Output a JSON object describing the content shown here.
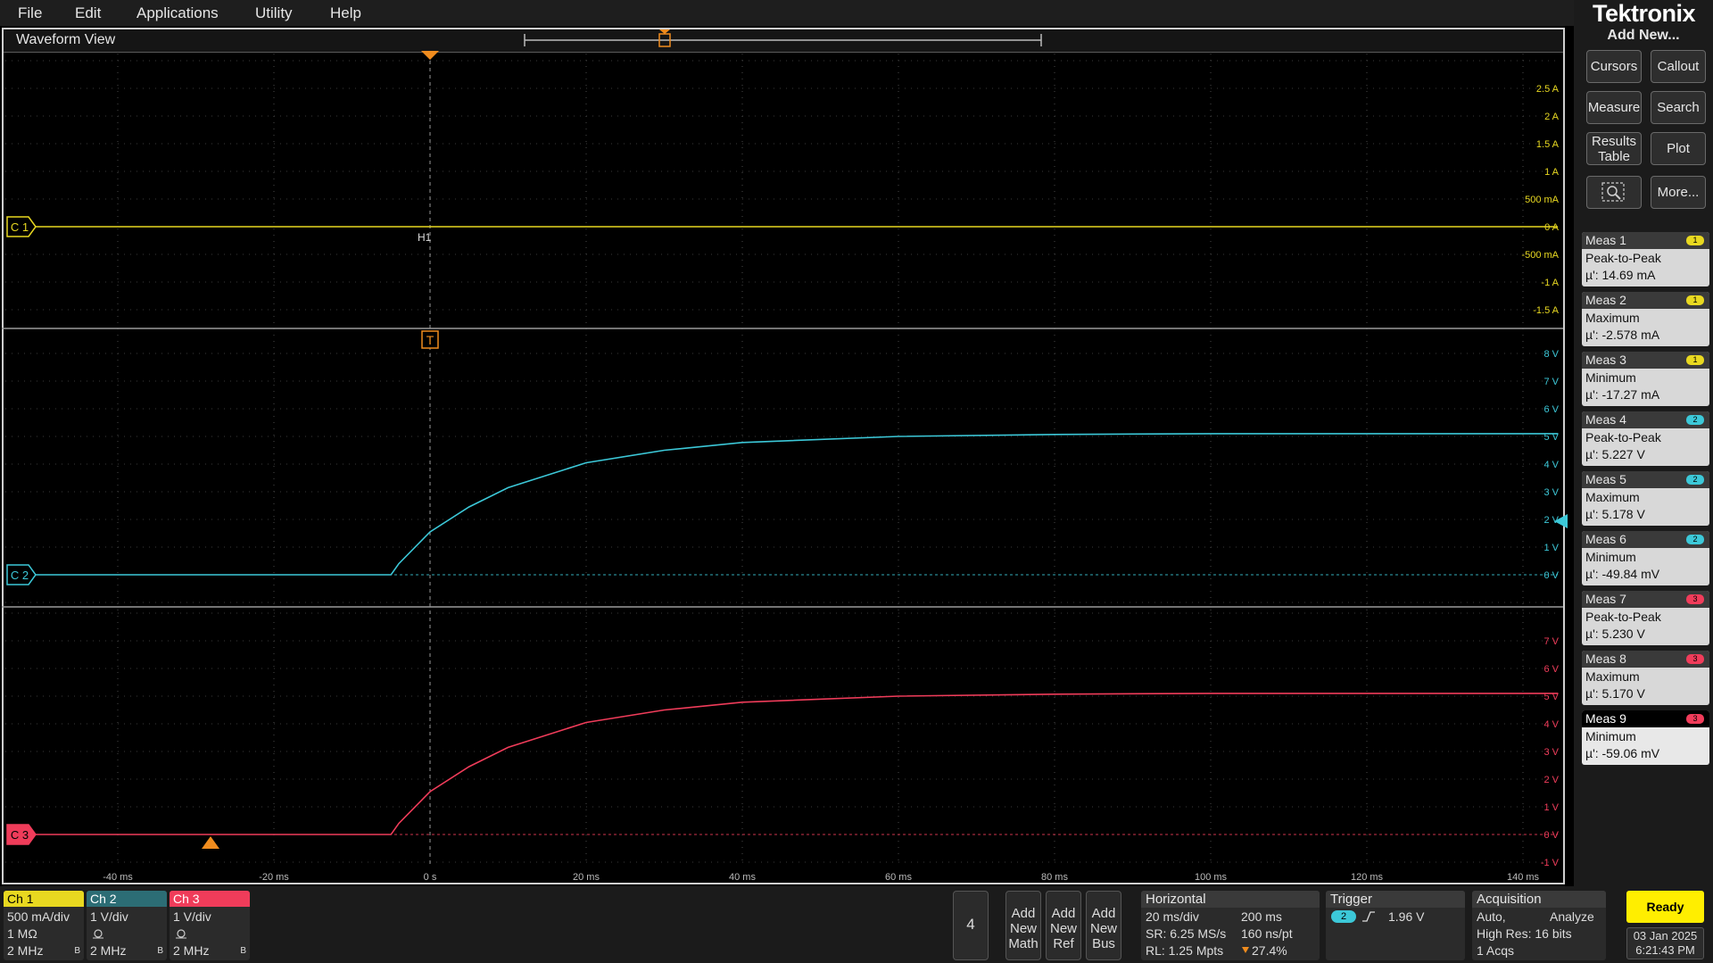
{
  "menu": {
    "items": [
      "File",
      "Edit",
      "Applications",
      "Utility",
      "Help"
    ]
  },
  "waveform_view": {
    "title": "Waveform View",
    "trigger_marker": "T",
    "cursor_label": "H1"
  },
  "scales": {
    "ch1_axis": [
      "2.5 A",
      "2 A",
      "1.5 A",
      "1 A",
      "500 mA",
      "0 A",
      "-500 mA",
      "-1 A",
      "-1.5 A"
    ],
    "ch2_axis": [
      "8 V",
      "7 V",
      "6 V",
      "5 V",
      "4 V",
      "3 V",
      "2 V",
      "1 V",
      "0 V"
    ],
    "ch3_axis": [
      "7 V",
      "6 V",
      "5 V",
      "4 V",
      "3 V",
      "2 V",
      "1 V",
      "0 V",
      "-1 V"
    ],
    "time_axis": [
      "-40 ms",
      "-20 ms",
      "0 s",
      "20 ms",
      "40 ms",
      "60 ms",
      "80 ms",
      "100 ms",
      "120 ms",
      "140 ms"
    ]
  },
  "chart_data": {
    "type": "line",
    "x_unit": "ms",
    "xlim": [
      -55,
      145
    ],
    "series": [
      {
        "name": "C 1",
        "color": "#e8d820",
        "x": [
          -55,
          145
        ],
        "y": [
          0,
          0
        ]
      },
      {
        "name": "C 2",
        "color": "#3cc8d8",
        "x": [
          -55,
          -5,
          -4,
          0,
          5,
          10,
          20,
          30,
          40,
          60,
          80,
          100,
          145
        ],
        "y": [
          0,
          0,
          0.4,
          1.55,
          2.45,
          3.15,
          4.05,
          4.5,
          4.78,
          5.0,
          5.07,
          5.1,
          5.1
        ]
      },
      {
        "name": "C 3",
        "color": "#f03c5a",
        "x": [
          -55,
          -5,
          -4,
          0,
          5,
          10,
          20,
          30,
          40,
          60,
          80,
          100,
          145
        ],
        "y": [
          0,
          0,
          0.4,
          1.55,
          2.45,
          3.15,
          4.05,
          4.5,
          4.78,
          5.0,
          5.07,
          5.1,
          5.1
        ]
      }
    ]
  },
  "right_panel": {
    "logo": "Tektronix",
    "add_new": "Add New...",
    "buttons": {
      "cursors": "Cursors",
      "callout": "Callout",
      "measure": "Measure",
      "search": "Search",
      "results_table": "Results Table",
      "plot": "Plot",
      "more": "More..."
    },
    "measurements": [
      {
        "title": "Meas 1",
        "type": "Peak-to-Peak",
        "value": "µ': 14.69 mA",
        "ch": "1",
        "color": "#e8d820"
      },
      {
        "title": "Meas 2",
        "type": "Maximum",
        "value": "µ': -2.578 mA",
        "ch": "1",
        "color": "#e8d820"
      },
      {
        "title": "Meas 3",
        "type": "Minimum",
        "value": "µ': -17.27 mA",
        "ch": "1",
        "color": "#e8d820"
      },
      {
        "title": "Meas 4",
        "type": "Peak-to-Peak",
        "value": "µ': 5.227 V",
        "ch": "2",
        "color": "#3cc8d8"
      },
      {
        "title": "Meas 5",
        "type": "Maximum",
        "value": "µ': 5.178 V",
        "ch": "2",
        "color": "#3cc8d8"
      },
      {
        "title": "Meas 6",
        "type": "Minimum",
        "value": "µ': -49.84 mV",
        "ch": "2",
        "color": "#3cc8d8"
      },
      {
        "title": "Meas 7",
        "type": "Peak-to-Peak",
        "value": "µ': 5.230 V",
        "ch": "3",
        "color": "#f03c5a"
      },
      {
        "title": "Meas 8",
        "type": "Maximum",
        "value": "µ': 5.170 V",
        "ch": "3",
        "color": "#f03c5a"
      },
      {
        "title": "Meas 9",
        "type": "Minimum",
        "value": "µ': -59.06 mV",
        "ch": "3",
        "color": "#f03c5a"
      }
    ]
  },
  "channels": [
    {
      "name": "Ch 1",
      "scale": "500 mA/div",
      "line2": "1 MΩ",
      "bw": "2 MHz",
      "bw_icon": "B",
      "color": "#e8d820"
    },
    {
      "name": "Ch 2",
      "scale": "1 V/div",
      "line2": "",
      "bw": "2 MHz",
      "bw_icon": "B",
      "color": "#3cc8d8"
    },
    {
      "name": "Ch 3",
      "scale": "1 V/div",
      "line2": "",
      "bw": "2 MHz",
      "bw_icon": "B",
      "color": "#f03c5a"
    }
  ],
  "bottom": {
    "channel_count": "4",
    "add_math": "Add New Math",
    "add_ref": "Add New Ref",
    "add_bus": "Add New Bus",
    "horizontal": {
      "title": "Horizontal",
      "scale": "20 ms/div",
      "record_time": "200 ms",
      "sr": "SR: 6.25 MS/s",
      "res": "160 ns/pt",
      "rl": "RL: 1.25 Mpts",
      "pos": "27.4%"
    },
    "trigger": {
      "title": "Trigger",
      "source": "2",
      "level": "1.96 V"
    },
    "acquisition": {
      "title": "Acquisition",
      "mode": "Auto,",
      "analyze": "Analyze",
      "hires": "High Res: 16 bits",
      "acqs": "1 Acqs"
    },
    "ready": "Ready",
    "date": "03 Jan 2025",
    "time": "6:21:43 PM"
  }
}
